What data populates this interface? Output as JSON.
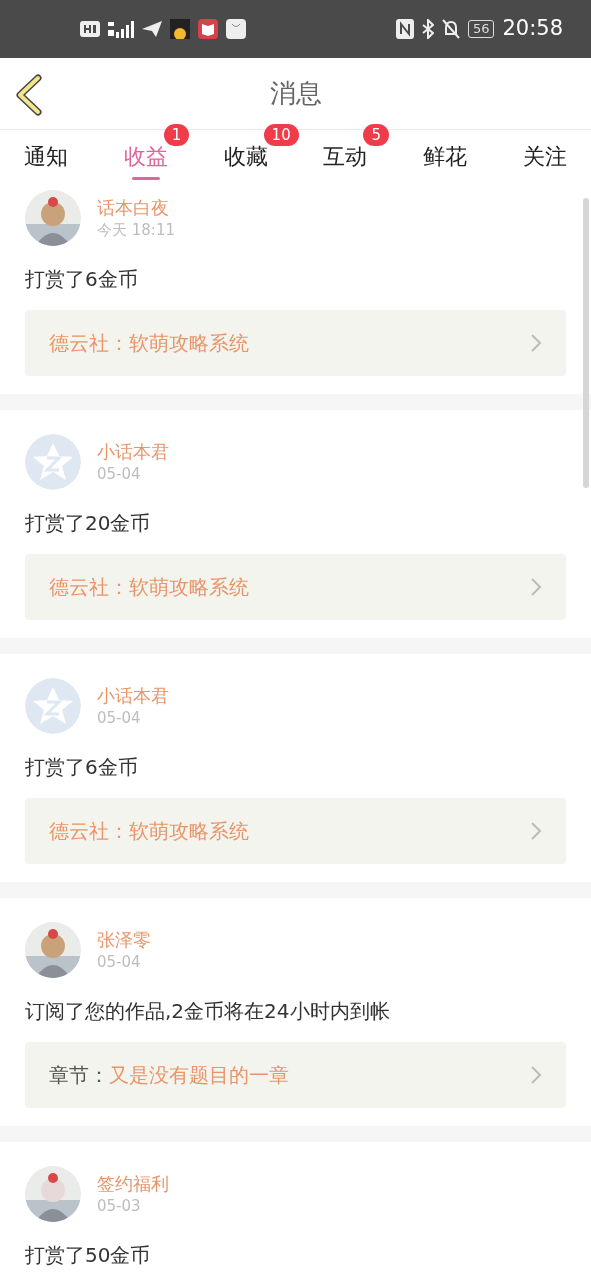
{
  "status_bar": {
    "battery": "56",
    "time": "20:58"
  },
  "header": {
    "title": "消息"
  },
  "tabs": [
    {
      "label": "通知",
      "selected": false
    },
    {
      "label": "收益",
      "selected": true,
      "badge": "1"
    },
    {
      "label": "收藏",
      "selected": false,
      "badge": "10"
    },
    {
      "label": "互动",
      "selected": false,
      "badge": "5"
    },
    {
      "label": "鲜花",
      "selected": false
    },
    {
      "label": "关注",
      "selected": false
    }
  ],
  "messages": [
    {
      "name": "话本白夜",
      "time": "今天 18:11",
      "text": "打赏了6金币",
      "link": {
        "kind": "work",
        "title": "德云社：软萌攻略系统"
      }
    },
    {
      "kind": "default",
      "name": "小话本君",
      "time": "05-04",
      "text": "打赏了20金币",
      "link": {
        "kind": "work",
        "title": "德云社：软萌攻略系统"
      }
    },
    {
      "kind": "default",
      "name": "小话本君",
      "time": "05-04",
      "text": "打赏了6金币",
      "link": {
        "kind": "work",
        "title": "德云社：软萌攻略系统"
      }
    },
    {
      "name": "张泽零",
      "time": "05-04",
      "text": "订阅了您的作品,2金币将在24小时内到帐",
      "link": {
        "kind": "chapter",
        "label": "章节：",
        "title": "又是没有题目的一章"
      }
    },
    {
      "name": "签约福利",
      "time": "05-03",
      "text": "打赏了50金币"
    }
  ]
}
